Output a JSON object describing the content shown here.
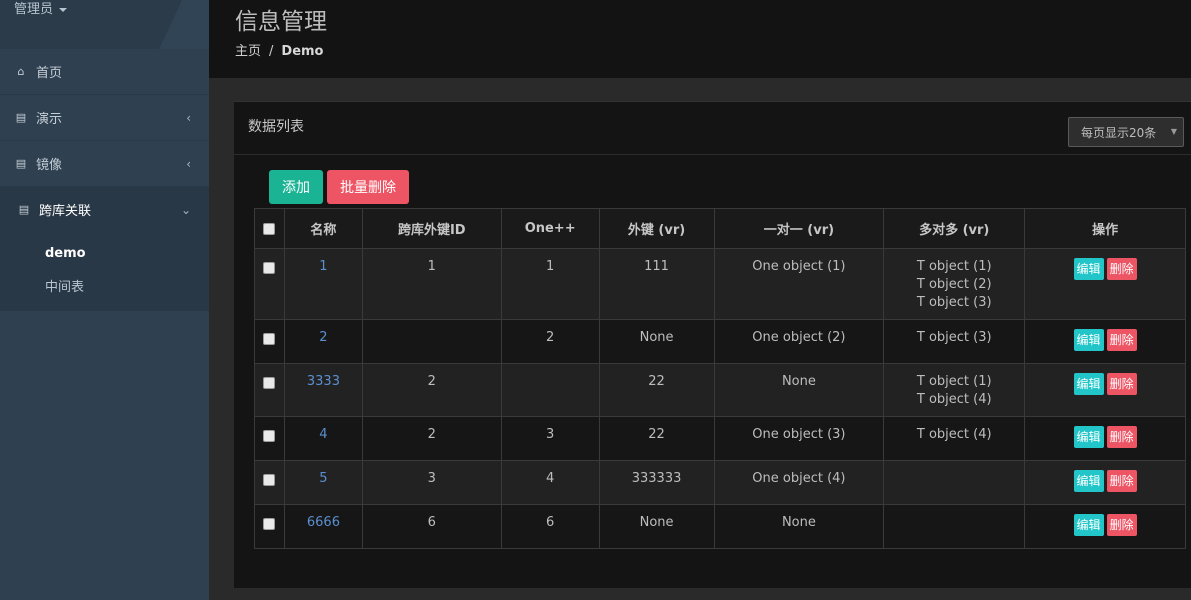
{
  "sidebar": {
    "user": "管理员",
    "items": [
      {
        "label": "首页",
        "icon": "home-icon"
      },
      {
        "label": "演示",
        "icon": "book-icon"
      },
      {
        "label": "镜像",
        "icon": "book-icon"
      },
      {
        "label": "跨库关联",
        "icon": "book-icon"
      }
    ],
    "sub_items": [
      {
        "label": "demo"
      },
      {
        "label": "中间表"
      }
    ]
  },
  "header": {
    "title": "信息管理",
    "breadcrumb": {
      "home": "主页",
      "separator": "/",
      "current": "Demo"
    }
  },
  "panel": {
    "title": "数据列表",
    "per_page": "每页显示20条",
    "add_label": "添加",
    "bulk_delete_label": "批量删除"
  },
  "table": {
    "columns": [
      "名称",
      "跨库外键ID",
      "One++",
      "外键 (vr)",
      "一对一 (vr)",
      "多对多 (vr)",
      "操作"
    ],
    "edit_label": "编辑",
    "delete_label": "删除",
    "rows": [
      {
        "name": "1",
        "fk_id": "1",
        "one": "1",
        "fk": "111",
        "o2o": "One object (1)",
        "m2m": [
          "T object (1)",
          "T object (2)",
          "T object (3)"
        ]
      },
      {
        "name": "2",
        "fk_id": "",
        "one": "2",
        "fk": "None",
        "o2o": "One object (2)",
        "m2m": [
          "T object (3)"
        ]
      },
      {
        "name": "3333",
        "fk_id": "2",
        "one": "",
        "fk": "22",
        "o2o": "None",
        "m2m": [
          "T object (1)",
          "T object (4)"
        ]
      },
      {
        "name": "4",
        "fk_id": "2",
        "one": "3",
        "fk": "22",
        "o2o": "One object (3)",
        "m2m": [
          "T object (4)"
        ]
      },
      {
        "name": "5",
        "fk_id": "3",
        "one": "4",
        "fk": "333333",
        "o2o": "One object (4)",
        "m2m": []
      },
      {
        "name": "6666",
        "fk_id": "6",
        "one": "6",
        "fk": "None",
        "o2o": "None",
        "m2m": []
      }
    ]
  },
  "colors": {
    "sidebar": "#2f4050",
    "add": "#1ab394",
    "delete": "#ed5565",
    "edit": "#23c6c8",
    "link": "#5b8fcf"
  }
}
